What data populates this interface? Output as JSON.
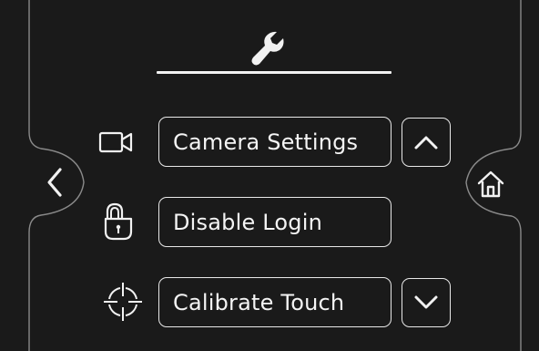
{
  "header": {
    "icon": "wrench-icon"
  },
  "menu": {
    "items": [
      {
        "label": "Camera Settings",
        "icon": "camera-icon"
      },
      {
        "label": "Disable Login",
        "icon": "lock-icon"
      },
      {
        "label": "Calibrate Touch",
        "icon": "target-icon"
      }
    ]
  },
  "navigation": {
    "back_icon": "chevron-left-icon",
    "home_icon": "home-icon",
    "scroll_up_icon": "chevron-up-icon",
    "scroll_down_icon": "chevron-down-icon"
  },
  "colors": {
    "background": "#1a1a1a",
    "foreground": "#f2f2f2",
    "frame_line": "#8a8a8a"
  }
}
